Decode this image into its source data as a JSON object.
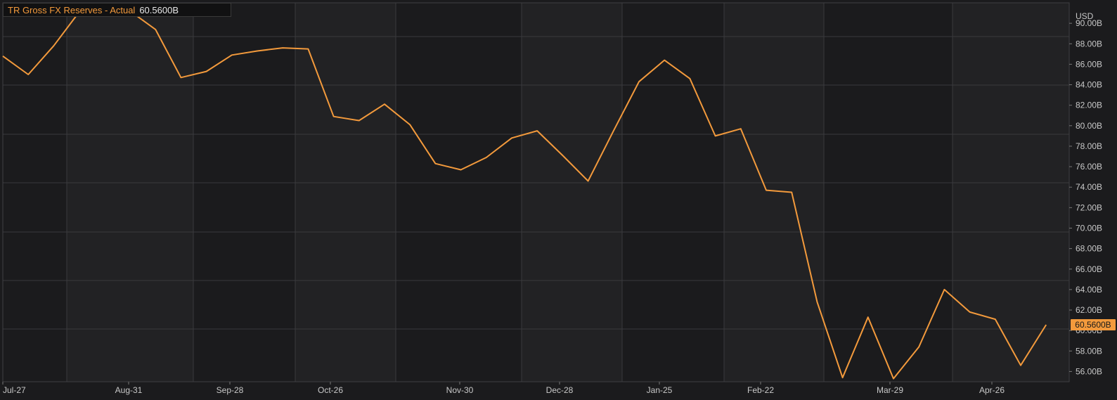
{
  "legend": {
    "series_label": "TR Gross FX Reserves - Actual",
    "last_value_label": "60.5600B"
  },
  "colors": {
    "background": "#1b1b1d",
    "band_light": "#222224",
    "grid": "#3a3a3d",
    "line": "#f39a3c",
    "axis_text": "#c8c8c8"
  },
  "chart_data": {
    "type": "line",
    "x_tick_labels": [
      "Jul-27",
      "Aug-31",
      "Sep-28",
      "Oct-26",
      "Nov-30",
      "Dec-28",
      "Jan-25",
      "Feb-22",
      "Mar-29",
      "Apr-26"
    ],
    "y_unit_label": "USD",
    "y_tick_labels": [
      "56.00B",
      "58.00B",
      "60.00B",
      "62.00B",
      "64.00B",
      "66.00B",
      "68.00B",
      "70.00B",
      "72.00B",
      "74.00B",
      "76.00B",
      "78.00B",
      "80.00B",
      "82.00B",
      "84.00B",
      "86.00B",
      "88.00B",
      "90.00B"
    ],
    "ylim": [
      55,
      92
    ],
    "grid": true,
    "last_value_label": "60.5600B",
    "series": [
      {
        "name": "TR Gross FX Reserves - Actual",
        "values": [
          86.8,
          85.0,
          87.8,
          91.1,
          91.2,
          91.2,
          89.4,
          84.7,
          85.3,
          86.9,
          87.3,
          87.6,
          87.5,
          80.9,
          80.5,
          82.1,
          80.1,
          76.3,
          75.7,
          76.9,
          78.8,
          79.5,
          77.1,
          74.6,
          79.5,
          84.3,
          86.4,
          84.6,
          79.0,
          79.7,
          73.7,
          73.5,
          62.8,
          55.4,
          61.3,
          55.3,
          58.4,
          64.0,
          61.8,
          61.1,
          56.6,
          60.56
        ]
      }
    ]
  }
}
